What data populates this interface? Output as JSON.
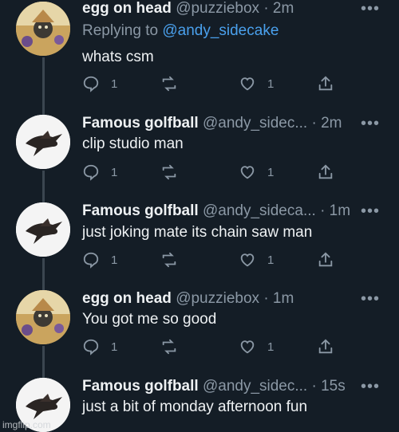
{
  "tweets": [
    {
      "name": "egg on head",
      "handle": "@puzziebox",
      "time": "· 2m",
      "replying_label": "Replying to ",
      "replying_to": "@andy_sidecake",
      "text": "whats csm",
      "replies": "1",
      "likes": "1",
      "avatar": "egg"
    },
    {
      "name": "Famous golfball",
      "handle": "@andy_sidec...",
      "time": "· 2m",
      "text": "clip studio man",
      "replies": "1",
      "likes": "1",
      "avatar": "golf"
    },
    {
      "name": "Famous golfball",
      "handle": "@andy_sideca...",
      "time": "· 1m",
      "text": "just joking mate its chain saw man",
      "replies": "1",
      "likes": "1",
      "avatar": "golf"
    },
    {
      "name": "egg on head",
      "handle": "@puzziebox",
      "time": "· 1m",
      "text": "You got me so good",
      "replies": "1",
      "likes": "1",
      "avatar": "egg"
    },
    {
      "name": "Famous golfball",
      "handle": "@andy_sidec...",
      "time": "· 15s",
      "text": "just a bit of monday afternoon fun",
      "avatar": "golf"
    }
  ],
  "more_glyph": "•••",
  "watermark": "imgflip.com",
  "colors": {
    "background": "#141d26",
    "mention": "#4aa0ec",
    "muted": "#8b98a5"
  }
}
